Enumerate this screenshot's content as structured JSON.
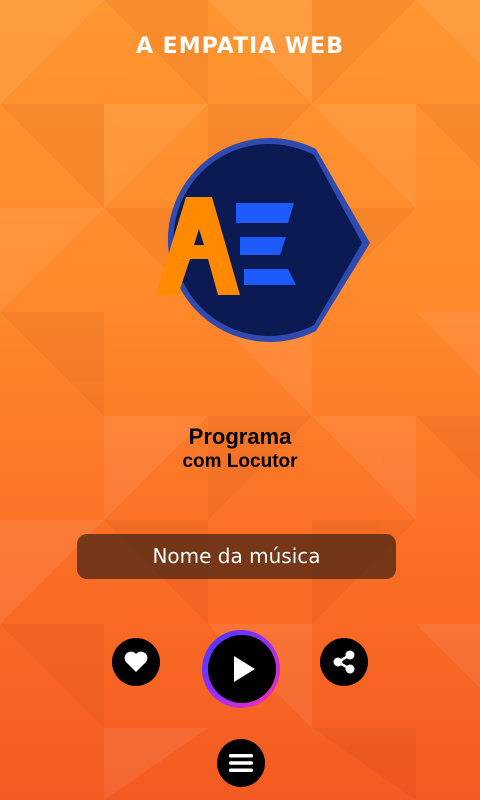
{
  "header": {
    "title": "A EMPATIA WEB"
  },
  "logo": {
    "letters": "AE",
    "colors": {
      "dark": "#0b1a52",
      "orange": "#ff8a00",
      "blue": "#1e5bff",
      "ring": "#2f4bb0"
    }
  },
  "program": {
    "name": "Programa",
    "host": "com Locutor"
  },
  "now_playing": {
    "song": "Nome da música"
  },
  "controls": {
    "like": {
      "icon": "heart-icon"
    },
    "play": {
      "icon": "play-icon"
    },
    "share": {
      "icon": "share-icon"
    },
    "menu": {
      "icon": "hamburger-menu-icon"
    }
  }
}
